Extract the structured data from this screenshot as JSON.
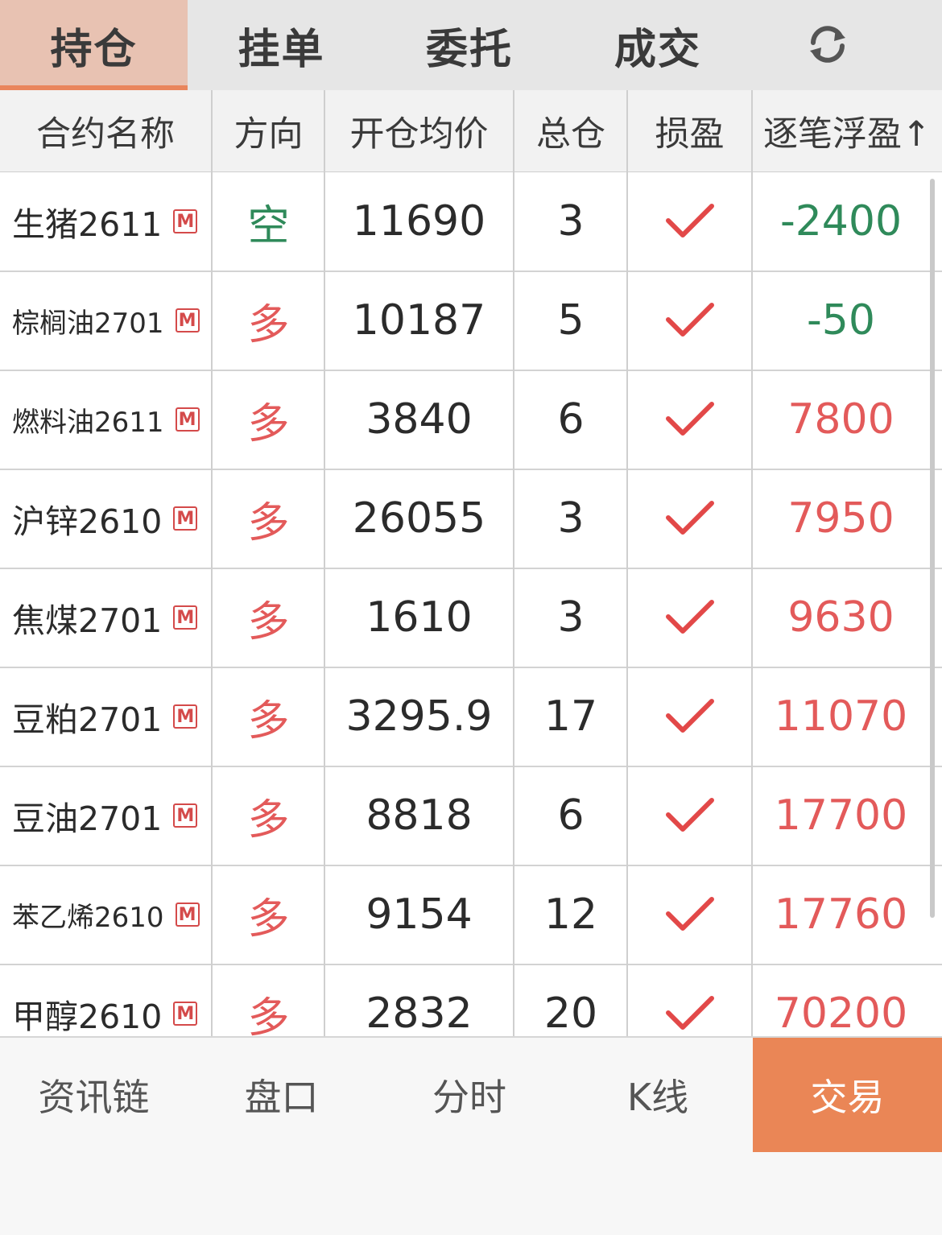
{
  "tabs": [
    {
      "label": "持仓",
      "active": true
    },
    {
      "label": "挂单",
      "active": false
    },
    {
      "label": "委托",
      "active": false
    },
    {
      "label": "成交",
      "active": false
    }
  ],
  "refresh_icon": "refresh-icon",
  "columns": [
    "合约名称",
    "方向",
    "开仓均价",
    "总仓",
    "损盈",
    "逐笔浮盈↑"
  ],
  "badge": "M",
  "rows": [
    {
      "name": "生猪2611",
      "direction": "空",
      "price": "11690",
      "total": "3",
      "pnl": "-2400"
    },
    {
      "name": "棕榈油2701",
      "direction": "多",
      "price": "10187",
      "total": "5",
      "pnl": "-50"
    },
    {
      "name": "燃料油2611",
      "direction": "多",
      "price": "3840",
      "total": "6",
      "pnl": "7800"
    },
    {
      "name": "沪锌2610",
      "direction": "多",
      "price": "26055",
      "total": "3",
      "pnl": "7950"
    },
    {
      "name": "焦煤2701",
      "direction": "多",
      "price": "1610",
      "total": "3",
      "pnl": "9630"
    },
    {
      "name": "豆粕2701",
      "direction": "多",
      "price": "3295.9",
      "total": "17",
      "pnl": "11070"
    },
    {
      "name": "豆油2701",
      "direction": "多",
      "price": "8818",
      "total": "6",
      "pnl": "17700"
    },
    {
      "name": "苯乙烯2610",
      "direction": "多",
      "price": "9154",
      "total": "12",
      "pnl": "17760"
    },
    {
      "name": "甲醇2610",
      "direction": "多",
      "price": "2832",
      "total": "20",
      "pnl": "70200"
    }
  ],
  "bottom_nav": [
    "资讯链",
    "盘口",
    "分时",
    "K线",
    "交易"
  ],
  "colors": {
    "accent": "#ea8656",
    "profit": "#e35a5a",
    "loss": "#2f8a5a",
    "short": "#2f8a5a",
    "long": "#e35a5a"
  }
}
